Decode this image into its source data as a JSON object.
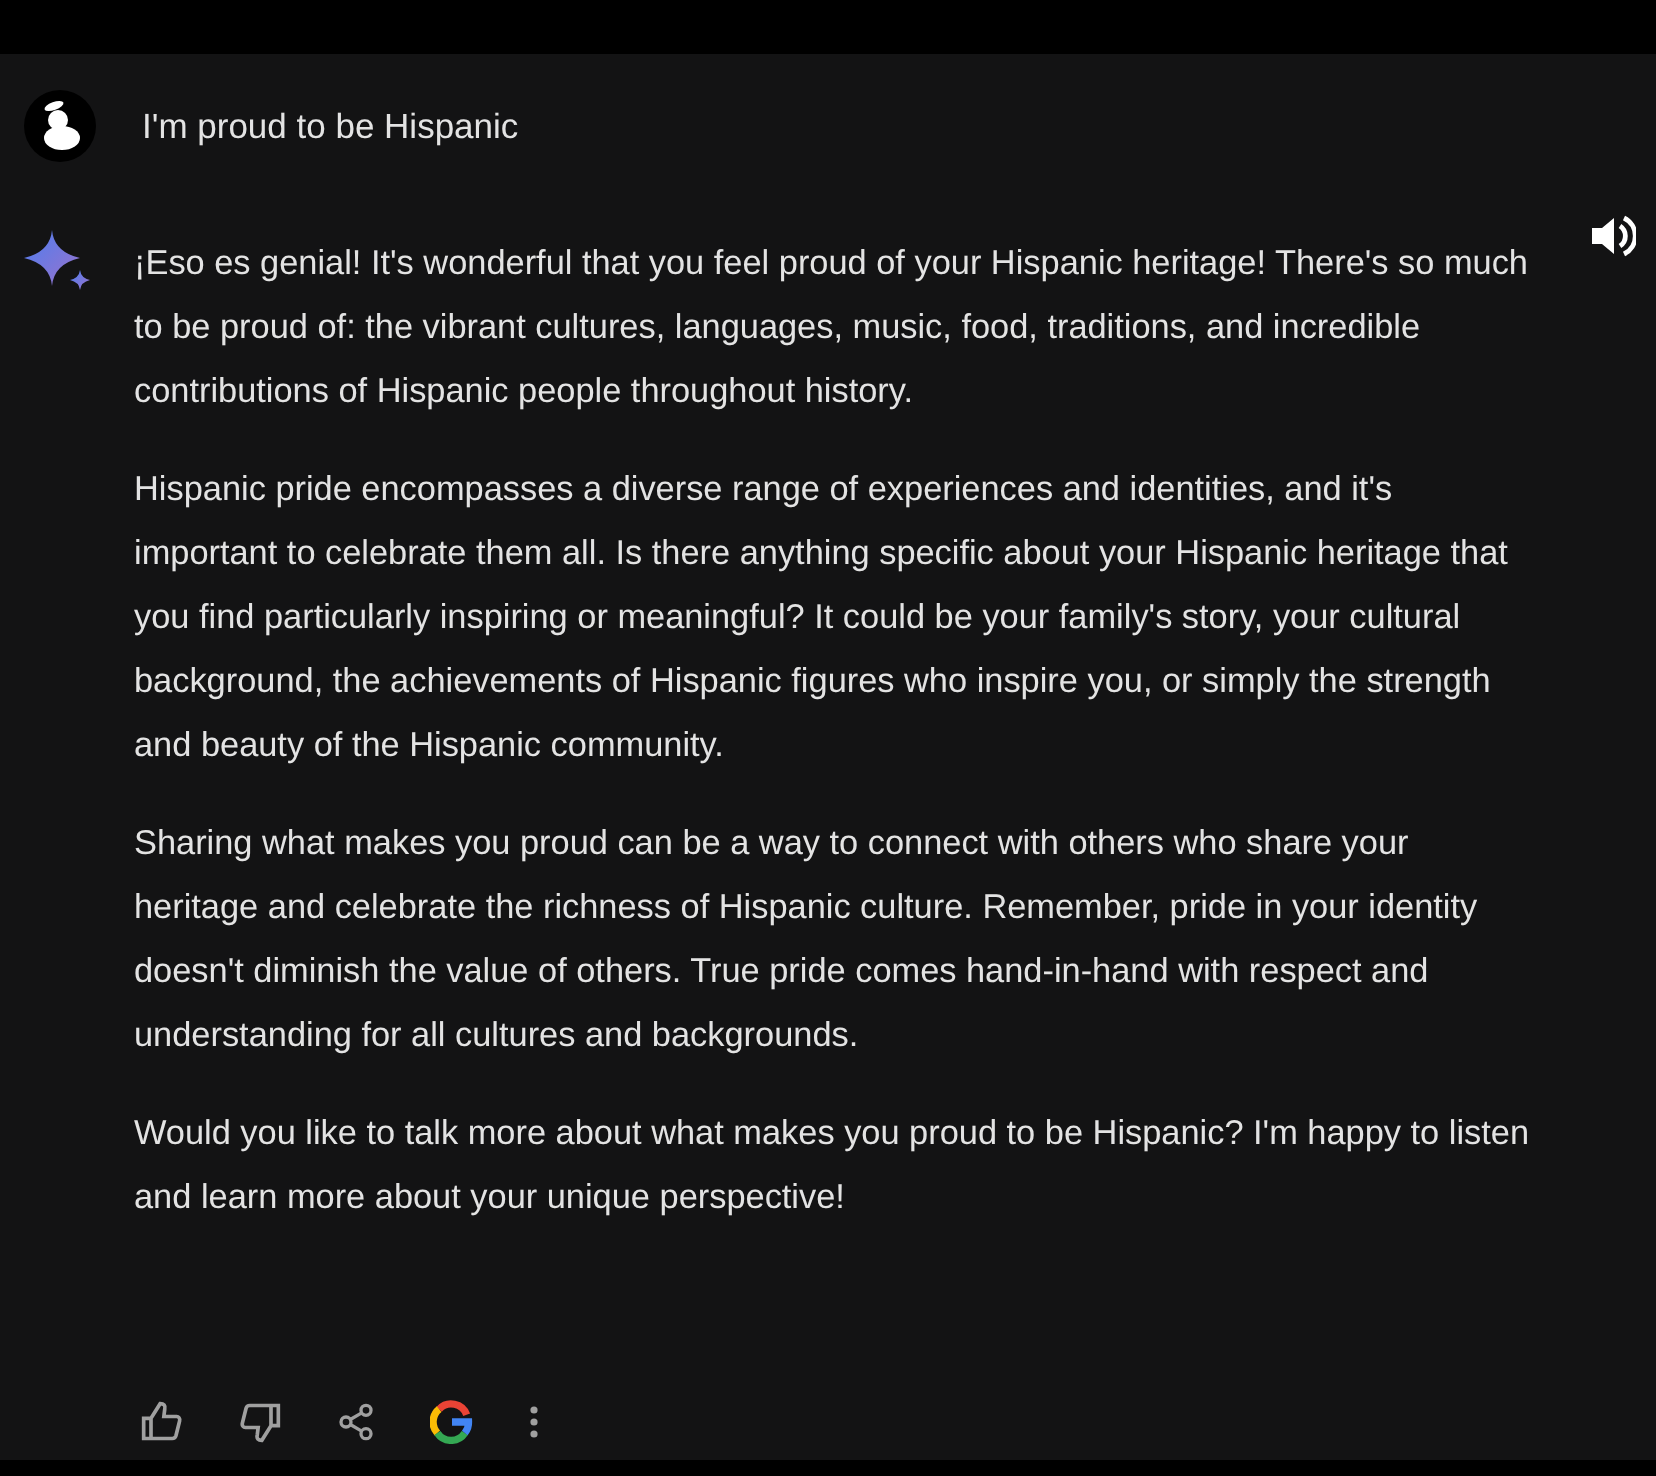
{
  "prompt": {
    "text": "I'm proud to be Hispanic"
  },
  "response": {
    "paragraphs": [
      "¡Eso es genial! It's wonderful that you feel proud of your Hispanic heritage! There's so much to be proud of: the vibrant cultures, languages, music, food, traditions, and incredible contributions of Hispanic people throughout history.",
      "Hispanic pride encompasses a diverse range of experiences and identities, and it's important to celebrate them all. Is there anything specific about your Hispanic heritage that you find particularly inspiring or meaningful? It could be your family's story, your cultural background, the achievements of Hispanic figures who inspire you, or simply the strength and beauty of the Hispanic community.",
      "Sharing what makes you proud can be a way to connect with others who share your heritage and celebrate the richness of Hispanic culture. Remember, pride in your identity doesn't diminish the value of others. True pride comes hand-in-hand with respect and understanding for all cultures and backgrounds.",
      "Would you like to talk more about what makes you proud to be Hispanic? I'm happy to listen and learn more about your unique perspective!"
    ]
  }
}
